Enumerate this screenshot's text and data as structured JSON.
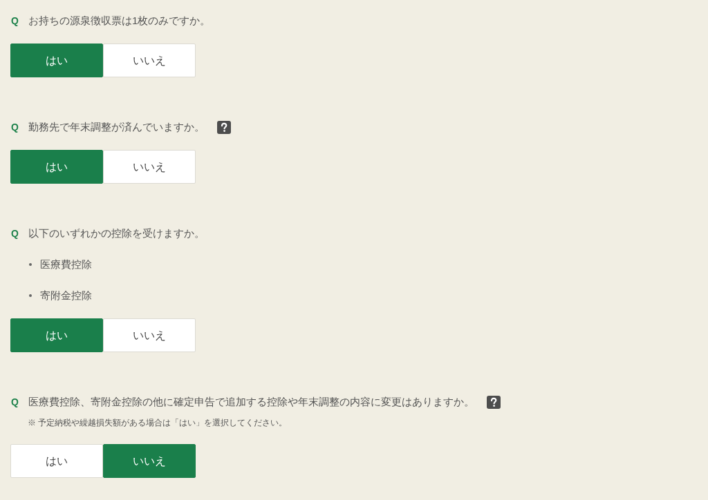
{
  "questions": [
    {
      "marker": "Q",
      "text": "お持ちの源泉徴収票は1枚のみですか。",
      "help": false,
      "options": [
        {
          "label": "はい",
          "selected": true
        },
        {
          "label": "いいえ",
          "selected": false
        }
      ]
    },
    {
      "marker": "Q",
      "text": "勤務先で年末調整が済んでいますか。",
      "help": true,
      "options": [
        {
          "label": "はい",
          "selected": true
        },
        {
          "label": "いいえ",
          "selected": false
        }
      ]
    },
    {
      "marker": "Q",
      "text": "以下のいずれかの控除を受けますか。",
      "help": false,
      "bullets": [
        "医療費控除",
        "寄附金控除"
      ],
      "options": [
        {
          "label": "はい",
          "selected": true
        },
        {
          "label": "いいえ",
          "selected": false
        }
      ]
    },
    {
      "marker": "Q",
      "text": "医療費控除、寄附金控除の他に確定申告で追加する控除や年末調整の内容に変更はありますか。",
      "help": true,
      "note": "※ 予定納税や繰越損失額がある場合は「はい」を選択してください。",
      "options": [
        {
          "label": "はい",
          "selected": false
        },
        {
          "label": "いいえ",
          "selected": true
        }
      ]
    }
  ]
}
